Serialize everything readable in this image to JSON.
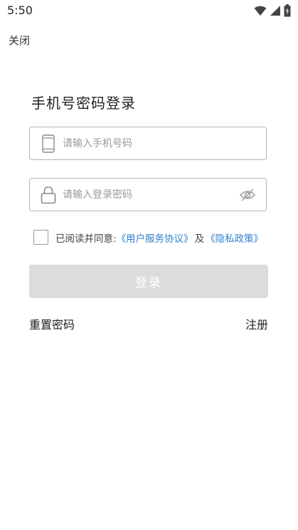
{
  "status_bar": {
    "time": "5:50",
    "icons": [
      "wifi-icon",
      "cellular-signal-icon",
      "battery-icon"
    ]
  },
  "nav": {
    "close_label": "关闭"
  },
  "title": "手机号密码登录",
  "phone_field": {
    "icon": "phone-icon",
    "value": "",
    "placeholder": "请输入手机号码"
  },
  "password_field": {
    "icon": "lock-icon",
    "value": "",
    "placeholder": "请输入登录密码",
    "toggle_icon": "eye-off-icon"
  },
  "agreement": {
    "checked": false,
    "prefix": "已阅读并同意:",
    "user_agreement": "《用户服务协议》",
    "and": "及",
    "privacy_policy": "《隐私政策》"
  },
  "login_button": {
    "label": "登录",
    "enabled": false
  },
  "footer_links": {
    "reset_password": "重置密码",
    "register": "注册"
  },
  "colors": {
    "link": "#2f7fd0",
    "button_disabled": "#dcdcdf",
    "border": "#b5b5b5",
    "placeholder": "#9a9a9a"
  }
}
